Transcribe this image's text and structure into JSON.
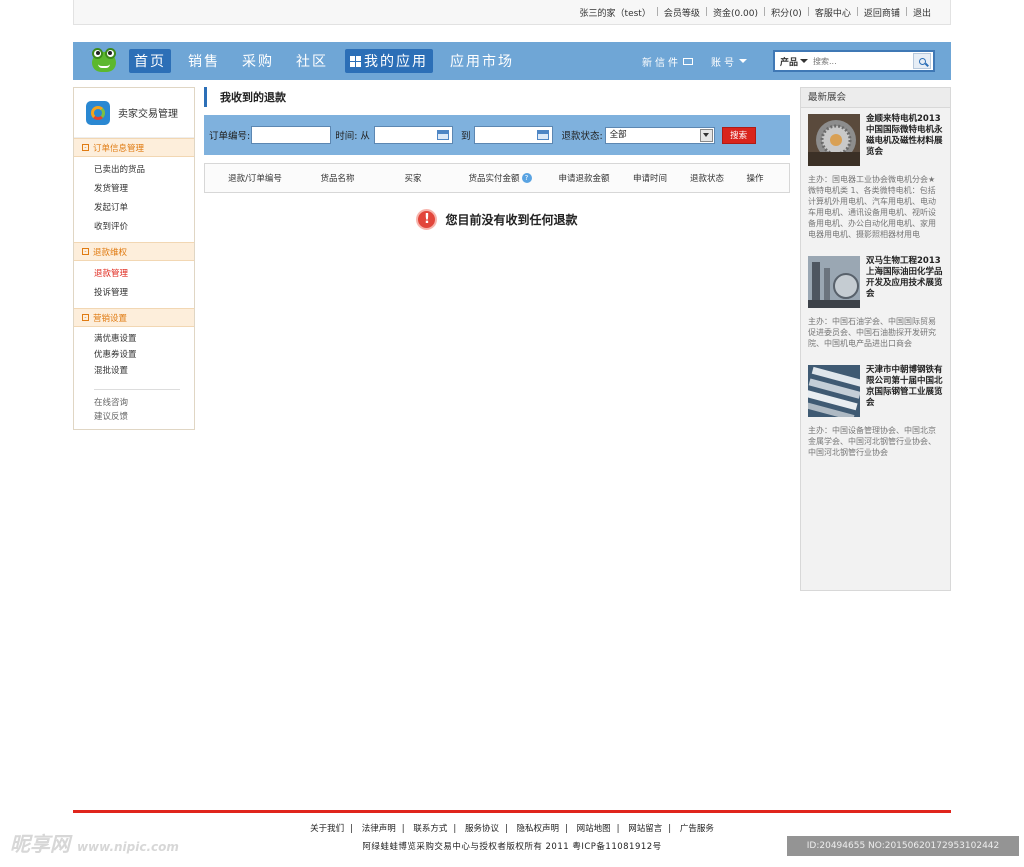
{
  "topbar": {
    "links": [
      "张三的家（test）",
      "会员等级",
      "资金(0.00)",
      "积分(0)",
      "客服中心",
      "返回商铺",
      "退出"
    ]
  },
  "nav": {
    "items": [
      "首页",
      "销售",
      "采购",
      "社区"
    ],
    "myapp": "我的应用",
    "market": "应用市场",
    "mail": "新信件",
    "account": "账号",
    "search_category": "产品",
    "search_placeholder": "搜索..."
  },
  "sidebar": {
    "title": "卖家交易管理",
    "sections": [
      {
        "label": "订单信息管理",
        "items": [
          "已卖出的货品",
          "发货管理",
          "发起订单",
          "收到评价"
        ]
      },
      {
        "label": "退款维权",
        "items": [
          "退款管理",
          "投诉管理"
        ]
      },
      {
        "label": "营销设置",
        "items": [
          "满优惠设置",
          "优惠券设置",
          "混批设置"
        ]
      }
    ],
    "help": [
      "在线咨询",
      "建议反馈"
    ]
  },
  "main": {
    "title": "我收到的退款",
    "filter": {
      "order_label": "订单编号:",
      "time_label": "时间: 从",
      "to_label": "到",
      "status_label": "退款状态:",
      "status_value": "全部",
      "search_button": "搜索"
    },
    "columns": [
      "退款/订单编号",
      "货品名称",
      "买家",
      "货品实付金额",
      "申请退款金额",
      "申请时间",
      "退款状态",
      "操作"
    ],
    "empty_message": "您目前没有收到任何退款"
  },
  "right_panel": {
    "title": "最新展会",
    "expos": [
      {
        "title": "金顺来特电机2013中国国际微特电机永磁电机及磁性材料展览会",
        "desc": "主办：国电器工业协会微电机分会★微特电机类 1、各类微特电机：包括计算机外用电机、汽车用电机、电动车用电机、通讯设备用电机、视听设备用电机、办公自动化用电机、家用电器用电机、摄影照相器材用电"
      },
      {
        "title": "双马生物工程2013上海国际油田化学品开发及应用技术展览会",
        "desc": "主办：中国石油学会、中国国际贸易促进委员会、中国石油勘探开发研究院、中国机电产品进出口商会"
      },
      {
        "title": "天津市中朝博钢铁有限公司第十届中国北京国际钢管工业展览会",
        "desc": "主办：中国设备管理协会、中国北京金属学会、中国河北钢管行业协会、中国河北钢管行业协会"
      }
    ]
  },
  "footer": {
    "links": [
      "关于我们",
      "法律声明",
      "联系方式",
      "服务协议",
      "隐私权声明",
      "网站地图",
      "网站留言",
      "广告服务"
    ],
    "copyright": "阿绿蛙蛙博览采购交易中心与授权者版权所有 2011 粤ICP备11081912号"
  },
  "watermark": {
    "left_brand": "昵享网",
    "left_url": "www.nipic.com",
    "right_id": "ID:20494655 NO:20150620172953102442"
  }
}
